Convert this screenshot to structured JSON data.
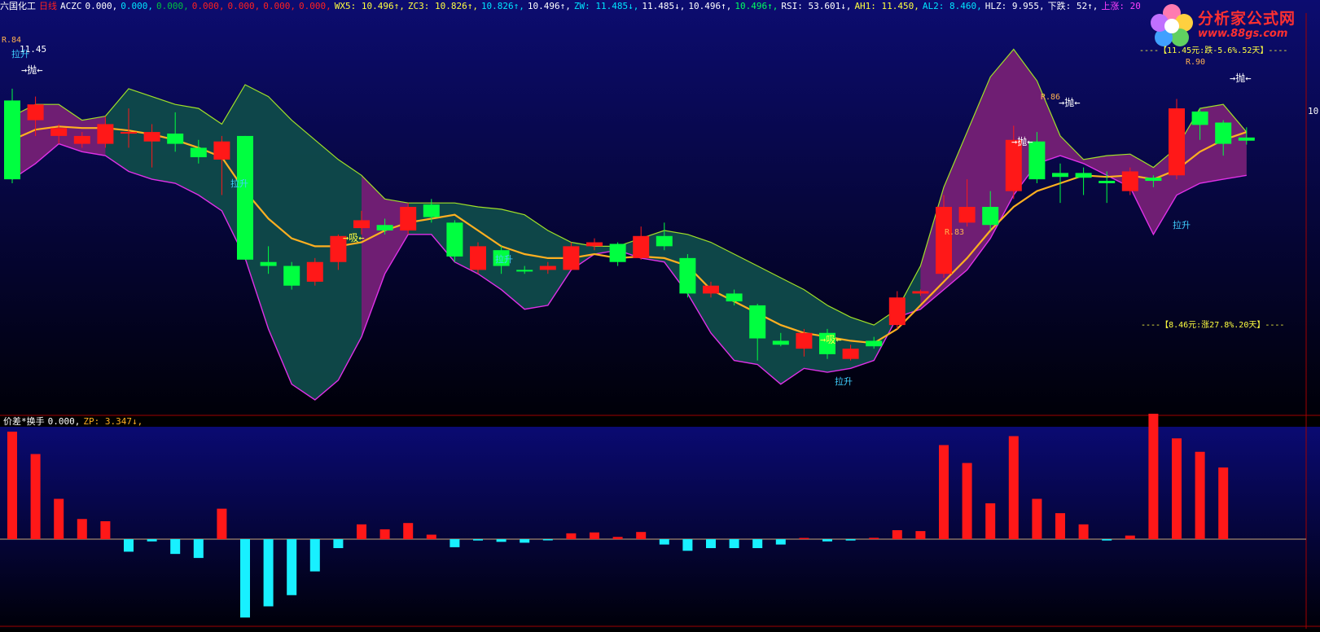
{
  "header": {
    "stock_name": "六国化工",
    "period": "日线",
    "items": [
      {
        "text": "ACZC",
        "color": "#ffffff"
      },
      {
        "text": "0.000,",
        "color": "#ffffff"
      },
      {
        "text": "0.000,",
        "color": "#00e5ff"
      },
      {
        "text": "0.000,",
        "color": "#00c040"
      },
      {
        "text": "0.000,",
        "color": "#ff2020"
      },
      {
        "text": "0.000,",
        "color": "#ff2020"
      },
      {
        "text": "0.000,",
        "color": "#ff2020"
      },
      {
        "text": "0.000,",
        "color": "#ff2020"
      },
      {
        "text": "WX5: 10.496↑,",
        "color": "#ffff40"
      },
      {
        "text": "ZC3: 10.826↑,",
        "color": "#ffff40"
      },
      {
        "text": "10.826↑,",
        "color": "#00e5ff"
      },
      {
        "text": "10.496↑,",
        "color": "#ffffff"
      },
      {
        "text": "ZW: 11.485↓,",
        "color": "#00e5ff"
      },
      {
        "text": "11.485↓,",
        "color": "#ffffff"
      },
      {
        "text": "10.496↑,",
        "color": "#ffffff"
      },
      {
        "text": "10.496↑,",
        "color": "#00ff60"
      },
      {
        "text": "RSI: 53.601↓,",
        "color": "#ffffff"
      },
      {
        "text": "AH1: 11.450,",
        "color": "#ffff40"
      },
      {
        "text": "AL2: 8.460,",
        "color": "#00e5ff"
      },
      {
        "text": "HLZ: 9.955,",
        "color": "#ffffff"
      },
      {
        "text": "下跌: 52↑,",
        "color": "#ffffff"
      },
      {
        "text": "上涨: 20↑,",
        "color": "#ff40ff"
      }
    ]
  },
  "logo": {
    "title": "分析家公式网",
    "url": "www.88gs.com"
  },
  "price_axis_label": "10",
  "upper_labels": {
    "top_price": "11.45",
    "r84": "R.84",
    "r83": "R.83",
    "r86": "R.86",
    "r90": "R.90",
    "pull_up": "拉升",
    "throw": "→抛←",
    "absorb": "→吸←",
    "top_note": "----【11.45元:跌-5.6%.52天】----",
    "bottom_note": "----【8.46元:涨27.8%.20天】----"
  },
  "subpanel": {
    "label": "价差*换手",
    "value": "0.000,",
    "zp": "ZP: 3.347↓,"
  },
  "candles": [
    {
      "o": 11.4,
      "c": 10.4,
      "h": 11.55,
      "l": 10.35
    },
    {
      "o": 11.15,
      "c": 11.35,
      "h": 11.45,
      "l": 10.95
    },
    {
      "o": 10.95,
      "c": 11.05,
      "h": 11.1,
      "l": 10.85
    },
    {
      "o": 10.85,
      "c": 10.95,
      "h": 11.0,
      "l": 10.8
    },
    {
      "o": 10.85,
      "c": 11.1,
      "h": 11.2,
      "l": 10.8
    },
    {
      "o": 10.98,
      "c": 11.0,
      "h": 11.3,
      "l": 10.8
    },
    {
      "o": 10.88,
      "c": 11.0,
      "h": 11.1,
      "l": 10.55
    },
    {
      "o": 10.98,
      "c": 10.85,
      "h": 11.25,
      "l": 10.75
    },
    {
      "o": 10.8,
      "c": 10.68,
      "h": 10.9,
      "l": 10.6
    },
    {
      "o": 10.65,
      "c": 10.88,
      "h": 10.95,
      "l": 10.2
    },
    {
      "o": 10.95,
      "c": 9.38,
      "h": 10.95,
      "l": 9.38
    },
    {
      "o": 9.35,
      "c": 9.3,
      "h": 9.55,
      "l": 9.2
    },
    {
      "o": 9.3,
      "c": 9.05,
      "h": 9.35,
      "l": 9.0
    },
    {
      "o": 9.1,
      "c": 9.35,
      "h": 9.4,
      "l": 9.05
    },
    {
      "o": 9.35,
      "c": 9.68,
      "h": 9.7,
      "l": 9.25
    },
    {
      "o": 9.78,
      "c": 9.88,
      "h": 10.0,
      "l": 9.7
    },
    {
      "o": 9.82,
      "c": 9.75,
      "h": 9.9,
      "l": 9.7
    },
    {
      "o": 9.75,
      "c": 10.05,
      "h": 10.1,
      "l": 9.7
    },
    {
      "o": 10.08,
      "c": 9.92,
      "h": 10.15,
      "l": 9.85
    },
    {
      "o": 9.85,
      "c": 9.42,
      "h": 9.88,
      "l": 9.35
    },
    {
      "o": 9.25,
      "c": 9.55,
      "h": 9.6,
      "l": 9.2
    },
    {
      "o": 9.5,
      "c": 9.3,
      "h": 9.55,
      "l": 9.2
    },
    {
      "o": 9.25,
      "c": 9.23,
      "h": 9.3,
      "l": 9.2
    },
    {
      "o": 9.25,
      "c": 9.3,
      "h": 9.35,
      "l": 9.2
    },
    {
      "o": 9.25,
      "c": 9.55,
      "h": 9.6,
      "l": 9.25
    },
    {
      "o": 9.55,
      "c": 9.6,
      "h": 9.65,
      "l": 9.5
    },
    {
      "o": 9.58,
      "c": 9.35,
      "h": 9.6,
      "l": 9.3
    },
    {
      "o": 9.4,
      "c": 9.68,
      "h": 9.8,
      "l": 9.38
    },
    {
      "o": 9.68,
      "c": 9.55,
      "h": 9.85,
      "l": 9.5
    },
    {
      "o": 9.4,
      "c": 8.95,
      "h": 9.45,
      "l": 8.9
    },
    {
      "o": 8.95,
      "c": 9.05,
      "h": 9.1,
      "l": 8.9
    },
    {
      "o": 8.95,
      "c": 8.85,
      "h": 9.0,
      "l": 8.8
    },
    {
      "o": 8.8,
      "c": 8.38,
      "h": 8.82,
      "l": 8.1
    },
    {
      "o": 8.35,
      "c": 8.3,
      "h": 8.45,
      "l": 8.28
    },
    {
      "o": 8.25,
      "c": 8.45,
      "h": 8.5,
      "l": 8.15
    },
    {
      "o": 8.45,
      "c": 8.18,
      "h": 8.5,
      "l": 8.12
    },
    {
      "o": 8.12,
      "c": 8.25,
      "h": 8.3,
      "l": 8.1
    },
    {
      "o": 8.35,
      "c": 8.28,
      "h": 8.4,
      "l": 8.25
    },
    {
      "o": 8.55,
      "c": 8.9,
      "h": 8.98,
      "l": 8.5
    },
    {
      "o": 8.95,
      "c": 8.98,
      "h": 9.0,
      "l": 8.92
    },
    {
      "o": 9.2,
      "c": 10.05,
      "h": 10.2,
      "l": 9.15
    },
    {
      "o": 9.85,
      "c": 10.05,
      "h": 10.4,
      "l": 9.8
    },
    {
      "o": 10.05,
      "c": 9.82,
      "h": 10.25,
      "l": 9.75
    },
    {
      "o": 10.25,
      "c": 10.9,
      "h": 11.08,
      "l": 10.15
    },
    {
      "o": 10.88,
      "c": 10.4,
      "h": 11.0,
      "l": 10.35
    },
    {
      "o": 10.48,
      "c": 10.43,
      "h": 10.6,
      "l": 10.1
    },
    {
      "o": 10.48,
      "c": 10.42,
      "h": 10.55,
      "l": 10.2
    },
    {
      "o": 10.38,
      "c": 10.35,
      "h": 10.5,
      "l": 10.1
    },
    {
      "o": 10.25,
      "c": 10.5,
      "h": 10.55,
      "l": 10.2
    },
    {
      "o": 10.42,
      "c": 10.38,
      "h": 10.45,
      "l": 10.3
    },
    {
      "o": 10.45,
      "c": 11.3,
      "h": 11.42,
      "l": 10.4
    },
    {
      "o": 11.26,
      "c": 11.09,
      "h": 11.3,
      "l": 10.9
    },
    {
      "o": 11.12,
      "c": 10.85,
      "h": 11.15,
      "l": 10.7
    },
    {
      "o": 10.93,
      "c": 10.89,
      "h": 11.06,
      "l": 10.84
    }
  ],
  "ma_line": [
    10.9,
    11.03,
    11.07,
    11.05,
    11.05,
    11.02,
    10.97,
    10.9,
    10.8,
    10.68,
    10.25,
    9.9,
    9.65,
    9.55,
    9.55,
    9.6,
    9.75,
    9.85,
    9.9,
    9.95,
    9.75,
    9.55,
    9.45,
    9.4,
    9.4,
    9.45,
    9.4,
    9.42,
    9.4,
    9.3,
    9.0,
    8.85,
    8.7,
    8.55,
    8.45,
    8.4,
    8.35,
    8.32,
    8.5,
    8.8,
    9.1,
    9.4,
    9.75,
    10.05,
    10.25,
    10.35,
    10.45,
    10.43,
    10.45,
    10.4,
    10.52,
    10.75,
    10.9,
    11.0
  ],
  "band_upper": [
    11.2,
    11.35,
    11.35,
    11.15,
    11.2,
    11.55,
    11.45,
    11.35,
    11.3,
    11.1,
    11.6,
    11.45,
    11.15,
    10.9,
    10.65,
    10.45,
    10.15,
    10.1,
    10.1,
    10.1,
    10.05,
    10.02,
    9.95,
    9.75,
    9.6,
    9.55,
    9.55,
    9.65,
    9.75,
    9.7,
    9.6,
    9.45,
    9.3,
    9.15,
    9.0,
    8.8,
    8.65,
    8.55,
    8.75,
    9.3,
    10.3,
    11.0,
    11.7,
    12.05,
    11.65,
    10.95,
    10.65,
    10.7,
    10.72,
    10.55,
    10.8,
    11.3,
    11.35,
    11.0
  ],
  "band_lower": [
    10.4,
    10.6,
    10.85,
    10.75,
    10.7,
    10.5,
    10.4,
    10.35,
    10.2,
    10.0,
    9.4,
    8.5,
    7.8,
    7.6,
    7.85,
    8.4,
    9.2,
    9.7,
    9.7,
    9.35,
    9.2,
    9.0,
    8.75,
    8.8,
    9.25,
    9.45,
    9.5,
    9.4,
    9.35,
    8.95,
    8.45,
    8.1,
    8.05,
    7.8,
    8.0,
    7.95,
    8.0,
    8.1,
    8.65,
    8.75,
    9.0,
    9.25,
    9.65,
    10.2,
    10.6,
    10.7,
    10.6,
    10.45,
    10.3,
    9.7,
    10.2,
    10.35,
    10.4,
    10.45
  ],
  "zones": [
    [
      0,
      4
    ],
    [
      15,
      17
    ],
    [
      39,
      53
    ]
  ],
  "histogram": [
    2.4,
    1.9,
    0.9,
    0.45,
    0.4,
    -0.28,
    -0.05,
    -0.33,
    -0.42,
    0.68,
    -1.75,
    -1.5,
    -1.25,
    -0.72,
    -0.2,
    0.33,
    0.22,
    0.36,
    0.1,
    -0.18,
    -0.03,
    -0.06,
    -0.08,
    -0.01,
    0.13,
    0.15,
    0.05,
    0.16,
    -0.12,
    -0.26,
    -0.2,
    -0.2,
    -0.2,
    -0.12,
    0.02,
    -0.05,
    -0.03,
    0.03,
    0.2,
    0.18,
    2.1,
    1.7,
    0.8,
    2.3,
    0.9,
    0.58,
    0.33,
    -0.03,
    0.08,
    2.8,
    2.25,
    1.95,
    1.6
  ],
  "colors": {
    "up": "#ff1818",
    "down": "#00ff40",
    "band_fill": "#0f4a4a",
    "zone_fill": "#7a1a78",
    "upper_band_line": "#a0e028",
    "lower_band_line": "#e030e8",
    "ma": "#ffb020",
    "hist_up": "#ff1818",
    "hist_down": "#18f0ff",
    "label_cyan": "#40d0ff",
    "label_yellow": "#ffff40",
    "label_white": "#ffffff"
  }
}
